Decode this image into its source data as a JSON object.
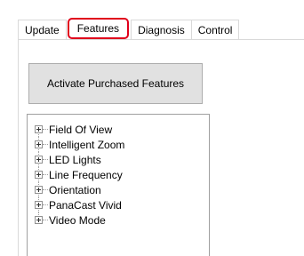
{
  "tabs": [
    {
      "label": "Update"
    },
    {
      "label": "Features",
      "selected": true
    },
    {
      "label": "Diagnosis"
    },
    {
      "label": "Control"
    }
  ],
  "features_tab": {
    "activate_button_label": "Activate Purchased Features",
    "tree_items": [
      {
        "label": "Field Of View"
      },
      {
        "label": "Intelligent Zoom"
      },
      {
        "label": "LED Lights"
      },
      {
        "label": "Line Frequency"
      },
      {
        "label": "Orientation"
      },
      {
        "label": "PanaCast Vivid"
      },
      {
        "label": "Video Mode"
      }
    ]
  },
  "colors": {
    "selected_tab_highlight": "#e0001b",
    "button_face": "#e1e1e1",
    "border": "#adadad"
  },
  "icons": {
    "tree_expander": "plus-box-icon"
  }
}
